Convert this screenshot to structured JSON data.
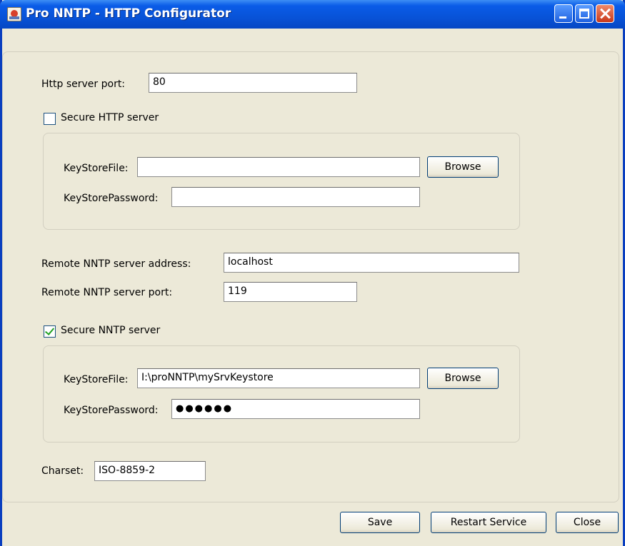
{
  "window": {
    "title": "Pro NNTP - HTTP Configurator"
  },
  "http": {
    "port_label": "Http server port:",
    "port_value": "80",
    "secure_label": "Secure HTTP server",
    "secure_checked": false,
    "keystore_file_label": "KeyStoreFile:",
    "keystore_file_value": "",
    "keystore_password_label": "KeyStorePassword:",
    "keystore_password_value": "",
    "browse_label": "Browse"
  },
  "nntp": {
    "address_label": "Remote NNTP server address:",
    "address_value": "localhost",
    "port_label": "Remote NNTP server port:",
    "port_value": "119",
    "secure_label": "Secure NNTP server",
    "secure_checked": true,
    "keystore_file_label": "KeyStoreFile:",
    "keystore_file_value": "I:\\proNNTP\\mySrvKeystore",
    "keystore_password_label": "KeyStorePassword:",
    "keystore_password_value": "●●●●●●",
    "browse_label": "Browse"
  },
  "charset": {
    "label": "Charset:",
    "value": "ISO-8859-2"
  },
  "buttons": {
    "save": "Save",
    "restart": "Restart Service",
    "close": "Close"
  },
  "icons": {
    "app": "java-app-icon",
    "minimize": "minimize-icon",
    "maximize": "maximize-icon",
    "close": "close-icon",
    "checkmark": "checkmark-icon"
  },
  "colors": {
    "titlebar": "#0853d8",
    "window_bg": "#ece9d8",
    "check": "#21a121"
  }
}
